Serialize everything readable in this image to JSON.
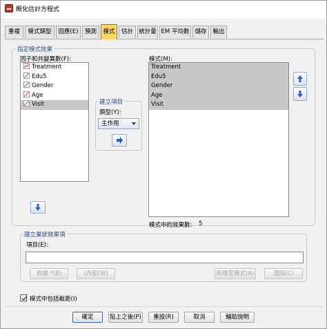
{
  "window": {
    "title": "概化估計方程式"
  },
  "tabs": [
    {
      "label": "重複"
    },
    {
      "label": "模式類型"
    },
    {
      "label": "回應(E)"
    },
    {
      "label": "預測"
    },
    {
      "label": "模式"
    },
    {
      "label": "估計"
    },
    {
      "label": "統計量"
    },
    {
      "label": "EM 平均數"
    },
    {
      "label": "儲存"
    },
    {
      "label": "輸出"
    }
  ],
  "specify_group": {
    "label": "指定模式效果"
  },
  "factors": {
    "label": "因子和共變異數(F):",
    "items": [
      {
        "label": "Treatment",
        "icon": "scale-variable-icon"
      },
      {
        "label": "Edu5",
        "icon": "scale-variable-icon"
      },
      {
        "label": "Gender",
        "icon": "scale-variable-icon"
      },
      {
        "label": "Age",
        "icon": "scale-variable-icon"
      },
      {
        "label": "Visit",
        "icon": "scale-variable-icon"
      }
    ]
  },
  "build_term": {
    "label": "建立項目",
    "type_label": "類型(Y):",
    "type_value": "主作用"
  },
  "model": {
    "label": "模式(M):",
    "items": [
      "Treatment",
      "Edu5",
      "Gender",
      "Age",
      "Visit"
    ],
    "count_label": "模式中的效果數:",
    "count_value": "5"
  },
  "nested_group": {
    "label": "建立巢狀效果項",
    "term_label": "項目(E):",
    "term_value": ""
  },
  "nested_buttons": {
    "by": "依據 *(B)",
    "within": "(內部(W)",
    "add": "新增至模式(A)",
    "clear": "清除(C)"
  },
  "intercept": {
    "label": "模式中包括截距(I)",
    "checked": true
  },
  "footer": {
    "ok": "確定",
    "paste": "貼上之後(P)",
    "reset": "重設(R)",
    "cancel": "取消",
    "help": "輔助說明"
  }
}
